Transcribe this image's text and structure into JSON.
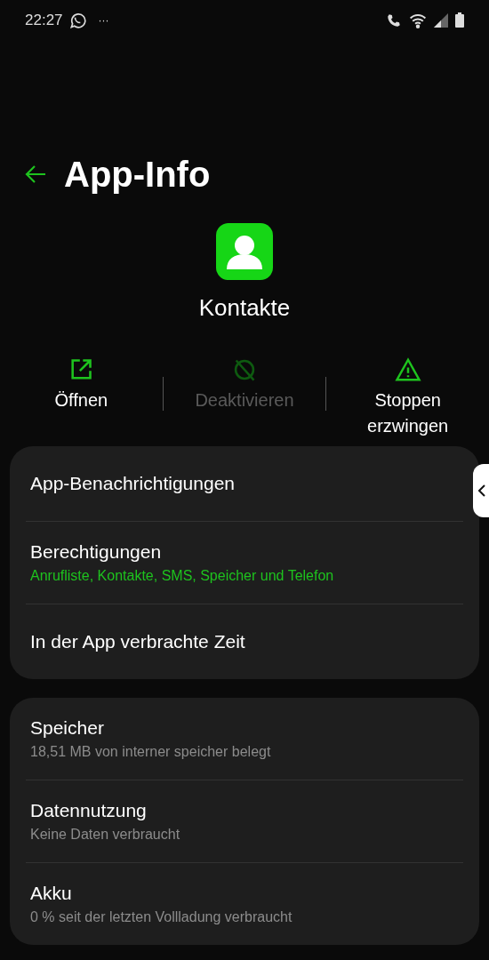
{
  "status_bar": {
    "time": "22:27",
    "more": "···"
  },
  "header": {
    "title": "App-Info"
  },
  "app": {
    "name": "Kontakte"
  },
  "actions": [
    {
      "kind": "open",
      "label": "Öffnen",
      "disabled": false
    },
    {
      "kind": "disable",
      "label": "Deaktivieren",
      "disabled": true
    },
    {
      "kind": "stop",
      "label": "Stoppen erzwingen",
      "disabled": false
    }
  ],
  "sections": [
    {
      "items": [
        {
          "title": "App-Benachrichtigungen"
        },
        {
          "title": "Berechtigungen",
          "subtitle": "Anrufliste, Kontakte, SMS, Speicher und Telefon",
          "highlighted": true
        },
        {
          "title": "In der App verbrachte Zeit"
        }
      ]
    },
    {
      "items": [
        {
          "title": "Speicher",
          "subtitle": "18,51 MB von interner speicher belegt",
          "highlighted": false
        },
        {
          "title": "Datennutzung",
          "subtitle": "Keine Daten verbraucht",
          "highlighted": false
        },
        {
          "title": "Akku",
          "subtitle": "0 % seit der letzten Vollladung verbraucht",
          "highlighted": false
        }
      ]
    }
  ]
}
